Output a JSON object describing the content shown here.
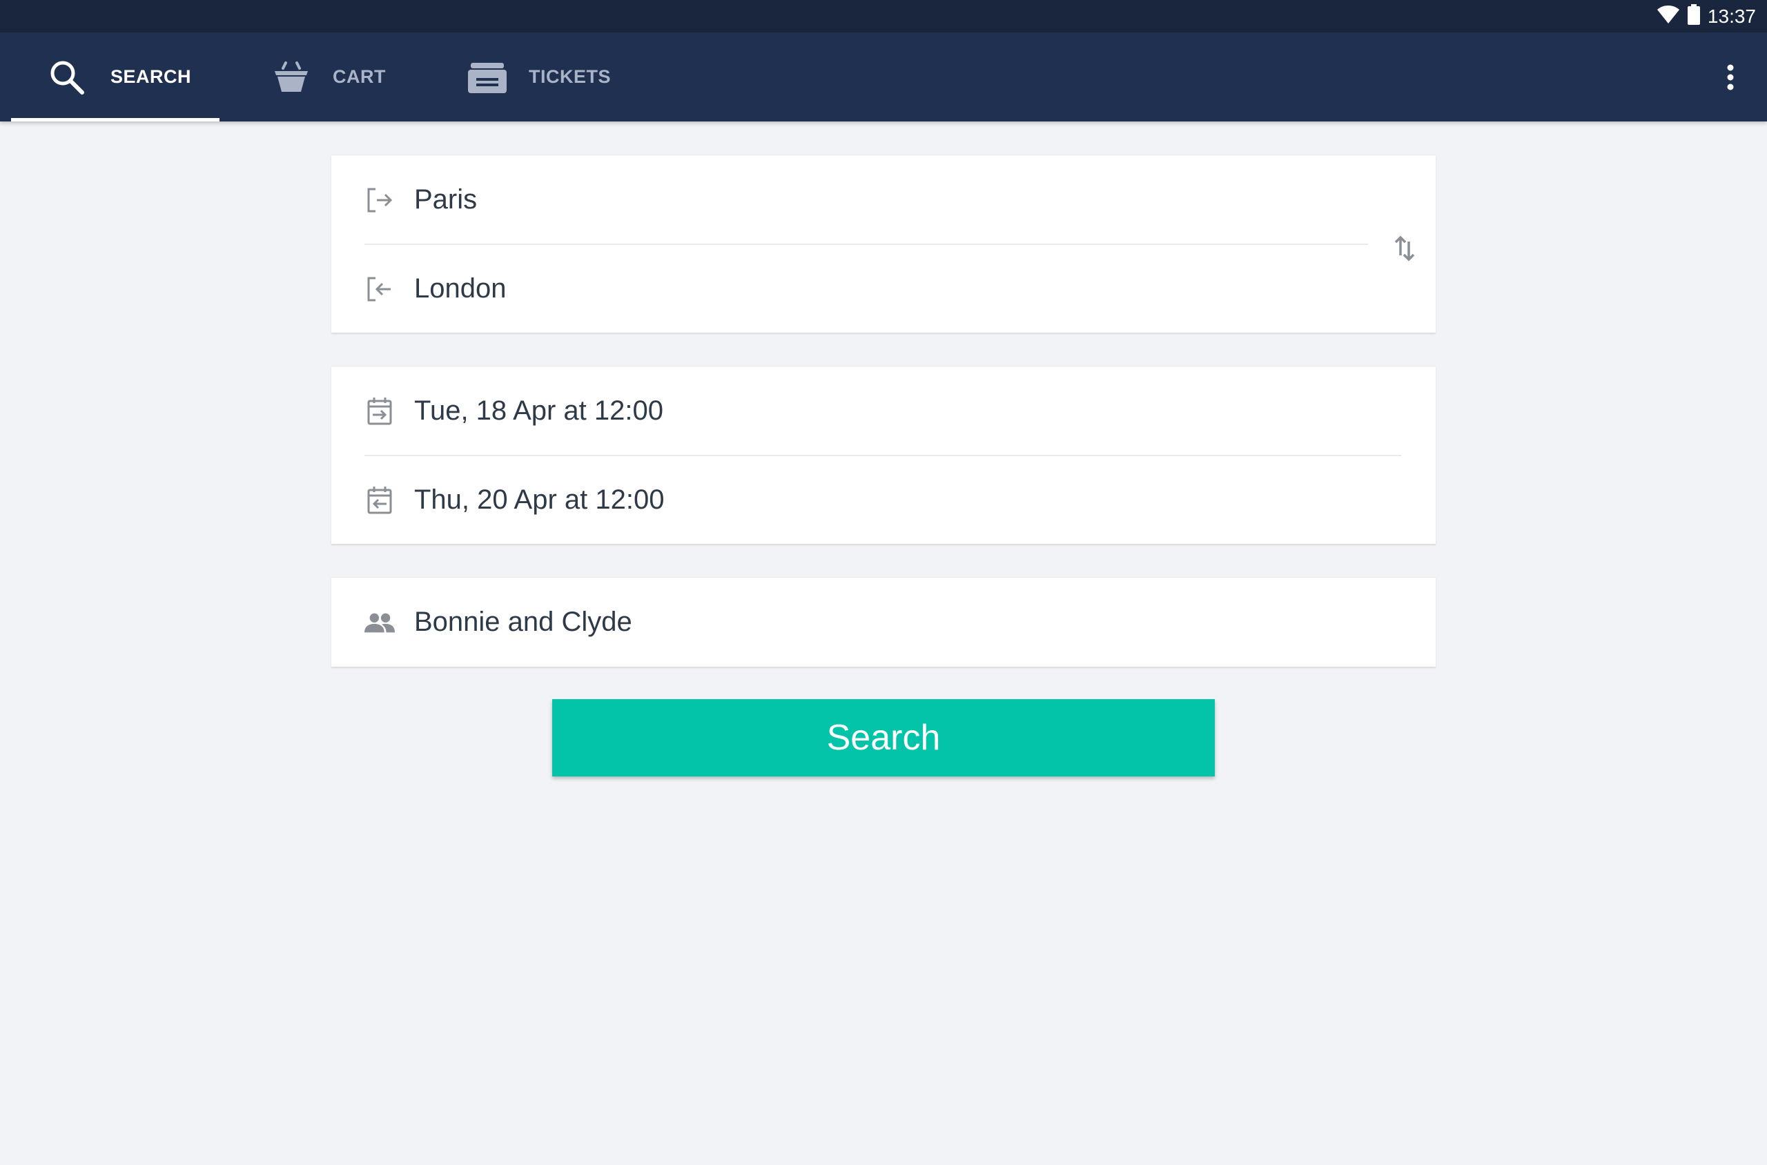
{
  "status_bar": {
    "time": "13:37",
    "icons": [
      "wifi-icon",
      "battery-icon"
    ]
  },
  "tabs": [
    {
      "label": "SEARCH",
      "icon": "search-icon",
      "active": true
    },
    {
      "label": "CART",
      "icon": "basket-icon",
      "active": false
    },
    {
      "label": "TICKETS",
      "icon": "ticket-icon",
      "active": false
    }
  ],
  "menu": {
    "icon": "more-vertical-icon"
  },
  "route": {
    "origin": "Paris",
    "destination": "London",
    "origin_icon": "departure-icon",
    "destination_icon": "arrival-icon",
    "swap_icon": "swap-icon"
  },
  "dates": {
    "outbound": "Tue, 18 Apr at 12:00",
    "return": "Thu, 20 Apr at 12:00",
    "outbound_icon": "calendar-out-icon",
    "return_icon": "calendar-return-icon"
  },
  "passengers": {
    "value": "Bonnie and Clyde",
    "icon": "people-icon"
  },
  "search_button": {
    "label": "Search"
  },
  "colors": {
    "status_bar": "#19263d",
    "app_bar": "#203050",
    "background": "#f2f3f7",
    "accent": "#03c4a9",
    "text": "#2f3a48",
    "icon_gray": "#8a8f96"
  }
}
